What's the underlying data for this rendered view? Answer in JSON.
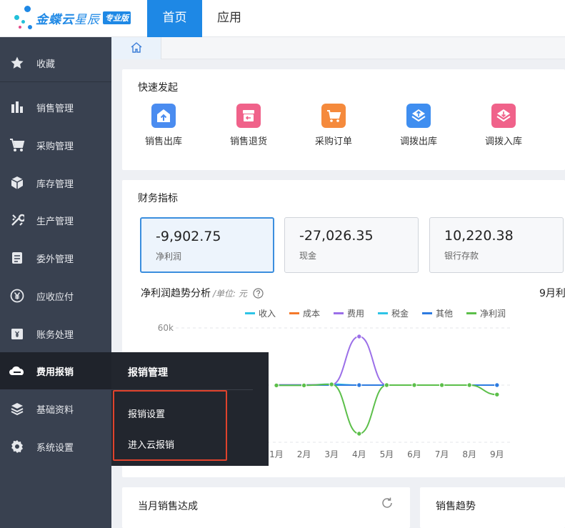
{
  "header": {
    "logo_brand": "金蝶云",
    "logo_product": "星辰",
    "logo_edition": "专业版",
    "tabs": [
      {
        "label": "首页",
        "active": true
      },
      {
        "label": "应用",
        "active": false
      }
    ]
  },
  "sidebar": {
    "items": [
      {
        "label": "收藏",
        "icon": "star-icon"
      },
      {
        "label": "销售管理",
        "icon": "bar-chart-icon"
      },
      {
        "label": "采购管理",
        "icon": "cart-icon"
      },
      {
        "label": "库存管理",
        "icon": "box-icon"
      },
      {
        "label": "生产管理",
        "icon": "wrench-icon"
      },
      {
        "label": "委外管理",
        "icon": "clipboard-icon"
      },
      {
        "label": "应收应付",
        "icon": "yen-coin-icon"
      },
      {
        "label": "账务处理",
        "icon": "ledger-icon"
      },
      {
        "label": "费用报销",
        "icon": "cloud-icon",
        "active": true
      },
      {
        "label": "基础资料",
        "icon": "layers-icon"
      },
      {
        "label": "系统设置",
        "icon": "gear-icon"
      }
    ]
  },
  "breadcrumb": {
    "home_icon": "home-icon"
  },
  "quick_start": {
    "title": "快速发起",
    "items": [
      {
        "label": "销售出库",
        "icon": "warehouse-out-icon",
        "color": "#4a8cf0"
      },
      {
        "label": "销售退货",
        "icon": "return-box-icon",
        "color": "#f0628a"
      },
      {
        "label": "采购订单",
        "icon": "cart-order-icon",
        "color": "#f58a3c"
      },
      {
        "label": "调拨出库",
        "icon": "transfer-out-icon",
        "color": "#3f8ef0"
      },
      {
        "label": "调拨入库",
        "icon": "transfer-in-icon",
        "color": "#f0628a"
      }
    ]
  },
  "finance": {
    "title": "财务指标",
    "metrics": [
      {
        "value": "-9,902.75",
        "label": "净利润",
        "active": true
      },
      {
        "value": "-27,026.35",
        "label": "现金",
        "active": false
      },
      {
        "value": "10,220.38",
        "label": "银行存款",
        "active": false
      }
    ],
    "trend_title": "净利润趋势分析",
    "trend_unit": "/单位: 元",
    "help_icon": "question-circle-icon",
    "period_label": "9月利"
  },
  "chart_data": {
    "type": "line",
    "title": "净利润趋势分析",
    "categories": [
      "1月",
      "2月",
      "3月",
      "4月",
      "5月",
      "6月",
      "7月",
      "8月",
      "9月"
    ],
    "yticks": [
      "60k"
    ],
    "ylim": [
      -60000,
      60000
    ],
    "legend_position": "top",
    "series": [
      {
        "name": "收入",
        "color": "#2ec4e6",
        "values": [
          0,
          0,
          1000,
          0,
          0,
          0,
          0,
          0,
          0
        ]
      },
      {
        "name": "成本",
        "color": "#f5792a",
        "values": [
          0,
          0,
          0,
          0,
          0,
          0,
          0,
          0,
          0
        ]
      },
      {
        "name": "费用",
        "color": "#9b6fe8",
        "values": [
          300,
          300,
          500,
          51000,
          0,
          0,
          0,
          0,
          0
        ]
      },
      {
        "name": "税金",
        "color": "#2ec4e6",
        "values": [
          0,
          0,
          0,
          0,
          0,
          0,
          0,
          0,
          0
        ]
      },
      {
        "name": "其他",
        "color": "#2d7be0",
        "values": [
          0,
          0,
          0,
          0,
          0,
          0,
          0,
          0,
          0
        ]
      },
      {
        "name": "净利润",
        "color": "#5cbf4a",
        "values": [
          -300,
          -300,
          800,
          -51000,
          0,
          0,
          0,
          0,
          -9902.75
        ]
      }
    ]
  },
  "flyout": {
    "title": "报销管理",
    "items": [
      "报销设置",
      "进入云报销"
    ]
  },
  "bottom": {
    "left_title": "当月销售达成",
    "refresh_icon": "refresh-icon",
    "right_title": "销售趋势"
  }
}
